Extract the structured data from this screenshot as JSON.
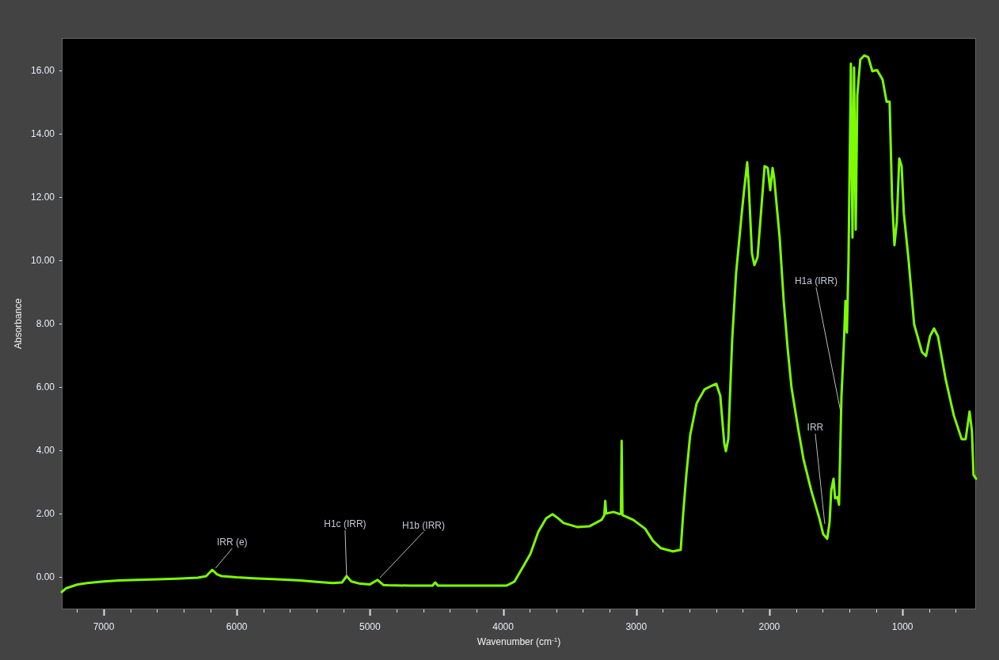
{
  "spectrum_plot": {
    "chart_data": {
      "type": "line",
      "xlabel": "Wavenumber (cm$^{-1}$)",
      "ylabel": "Absorbance",
      "x": [
        7315,
        7280,
        7200,
        7125,
        7000,
        6887,
        6750,
        6590,
        6450,
        6293,
        6230,
        6185,
        6150,
        6114,
        6000,
        5876,
        5700,
        5520,
        5400,
        5282,
        5210,
        5175,
        5140,
        5074,
        5000,
        4943,
        4900,
        4866,
        4700,
        4530,
        4510,
        4490,
        4212,
        3974,
        3914,
        3855,
        3795,
        3736,
        3677,
        3629,
        3587,
        3546,
        3440,
        3350,
        3261,
        3240,
        3233,
        3226,
        3171,
        3124,
        3115,
        3110,
        3104,
        3023,
        2933,
        2874,
        2814,
        2725,
        2666,
        2648,
        2624,
        2595,
        2547,
        2488,
        2428,
        2399,
        2369,
        2339,
        2327,
        2309,
        2280,
        2250,
        2208,
        2190,
        2167,
        2155,
        2131,
        2113,
        2089,
        2059,
        2036,
        2012,
        1994,
        1976,
        1964,
        1923,
        1893,
        1863,
        1834,
        1786,
        1744,
        1685,
        1625,
        1596,
        1566,
        1548,
        1536,
        1518,
        1507,
        1489,
        1477,
        1459,
        1441,
        1429,
        1418,
        1406,
        1388,
        1376,
        1364,
        1352,
        1340,
        1317,
        1287,
        1257,
        1227,
        1192,
        1150,
        1120,
        1097,
        1079,
        1061,
        1043,
        1025,
        1007,
        990,
        954,
        913,
        854,
        824,
        794,
        764,
        734,
        675,
        615,
        556,
        526,
        497,
        479,
        467,
        448
      ],
      "series": [
        {
          "color": "#7cfc00",
          "values": [
            -0.48,
            -0.36,
            -0.25,
            -0.2,
            -0.15,
            -0.12,
            -0.1,
            -0.08,
            -0.06,
            -0.03,
            0.02,
            0.22,
            0.08,
            0.02,
            -0.02,
            -0.05,
            -0.08,
            -0.12,
            -0.16,
            -0.2,
            -0.18,
            0.02,
            -0.15,
            -0.22,
            -0.24,
            -0.1,
            -0.26,
            -0.27,
            -0.28,
            -0.28,
            -0.18,
            -0.28,
            -0.28,
            -0.28,
            -0.15,
            0.28,
            0.72,
            1.42,
            1.85,
            1.98,
            1.85,
            1.7,
            1.57,
            1.6,
            1.8,
            1.95,
            2.4,
            2.0,
            2.05,
            1.98,
            2.0,
            4.3,
            1.95,
            1.8,
            1.52,
            1.13,
            0.9,
            0.8,
            0.85,
            1.98,
            3.22,
            4.48,
            5.48,
            5.92,
            6.05,
            6.1,
            5.72,
            4.22,
            3.97,
            4.35,
            7.48,
            9.6,
            11.48,
            12.22,
            13.1,
            12.35,
            10.22,
            9.85,
            10.1,
            11.72,
            12.98,
            12.92,
            12.22,
            12.92,
            12.6,
            10.72,
            8.72,
            7.22,
            5.98,
            4.72,
            3.72,
            2.72,
            1.85,
            1.35,
            1.2,
            1.72,
            2.72,
            3.1,
            2.48,
            2.52,
            2.28,
            5.72,
            7.35,
            8.72,
            7.72,
            9.98,
            16.22,
            10.72,
            16.1,
            10.97,
            15.22,
            16.35,
            16.48,
            16.42,
            15.98,
            16.02,
            15.72,
            15.02,
            15.02,
            11.98,
            10.48,
            11.22,
            13.22,
            12.98,
            11.48,
            9.98,
            7.98,
            7.1,
            6.98,
            7.6,
            7.85,
            7.6,
            6.22,
            5.1,
            4.35,
            4.35,
            5.22,
            4.6,
            3.22,
            3.1
          ]
        }
      ],
      "xlim": [
        7315,
        448
      ],
      "ylim": [
        -1.03,
        17.03
      ],
      "xticks": [
        7000,
        6000,
        5000,
        4000,
        3000,
        2000,
        1000
      ],
      "yticks": [
        {
          "value": 0,
          "label": "0.00"
        },
        {
          "value": 2,
          "label": "2.00"
        },
        {
          "value": 4,
          "label": "4.00"
        },
        {
          "value": 6,
          "label": "6.00"
        },
        {
          "value": 8,
          "label": "8.00"
        },
        {
          "value": 10,
          "label": "10.00"
        },
        {
          "value": 12,
          "label": "12.00"
        },
        {
          "value": 14,
          "label": "14.00"
        },
        {
          "value": 16,
          "label": "16.00"
        }
      ],
      "annotations": [
        {
          "text": "IRR (e)",
          "x": 6160,
          "y": 0.27
        },
        {
          "text": "H1c (IRR)",
          "x": 5175,
          "y": -0.03
        },
        {
          "text": "H1b (IRR)",
          "x": 4925,
          "y": -0.03
        },
        {
          "text": "H1a (IRR)",
          "x": 1465,
          "y": 5.22
        },
        {
          "text": "IRR",
          "x": 1584,
          "y": 1.67
        }
      ]
    }
  }
}
